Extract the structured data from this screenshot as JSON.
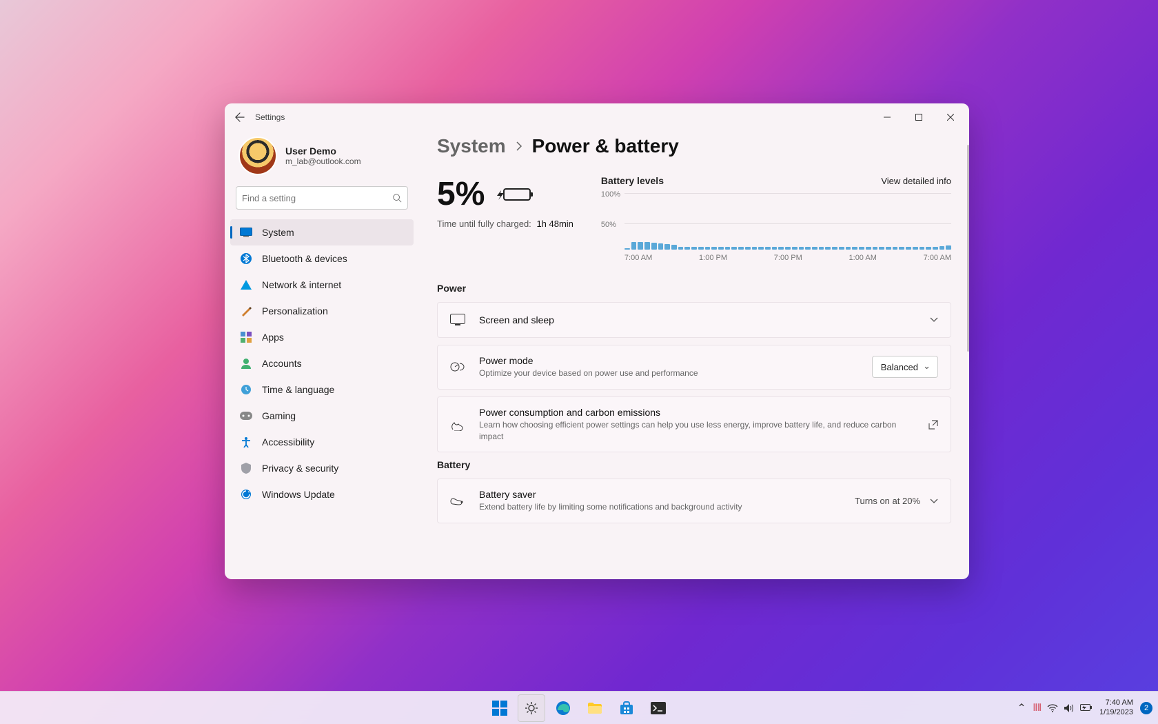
{
  "window": {
    "title": "Settings"
  },
  "user": {
    "name": "User Demo",
    "email": "m_lab@outlook.com"
  },
  "search": {
    "placeholder": "Find a setting"
  },
  "nav": [
    {
      "label": "System",
      "icon": "system",
      "active": true
    },
    {
      "label": "Bluetooth & devices",
      "icon": "bluetooth"
    },
    {
      "label": "Network & internet",
      "icon": "network"
    },
    {
      "label": "Personalization",
      "icon": "personalization"
    },
    {
      "label": "Apps",
      "icon": "apps"
    },
    {
      "label": "Accounts",
      "icon": "accounts"
    },
    {
      "label": "Time & language",
      "icon": "time"
    },
    {
      "label": "Gaming",
      "icon": "gaming"
    },
    {
      "label": "Accessibility",
      "icon": "accessibility"
    },
    {
      "label": "Privacy & security",
      "icon": "privacy"
    },
    {
      "label": "Windows Update",
      "icon": "update"
    }
  ],
  "breadcrumb": {
    "parent": "System",
    "current": "Power & battery"
  },
  "battery": {
    "percent": "5%",
    "time_label": "Time until fully charged:",
    "time_value": "1h 48min"
  },
  "chart_data": {
    "type": "bar",
    "title": "Battery levels",
    "link": "View detailed info",
    "ylabel": "",
    "ylim": [
      0,
      100
    ],
    "y_ticks": [
      "100%",
      "50%"
    ],
    "categories": [
      "7:00 AM",
      "1:00 PM",
      "7:00 PM",
      "1:00 AM",
      "7:00 AM"
    ],
    "values": [
      3,
      14,
      14,
      13,
      12,
      11,
      10,
      9,
      5,
      5,
      5,
      5,
      5,
      5,
      5,
      5,
      5,
      5,
      5,
      5,
      5,
      5,
      5,
      5,
      5,
      5,
      5,
      5,
      5,
      5,
      5,
      5,
      5,
      5,
      5,
      5,
      5,
      5,
      5,
      5,
      5,
      5,
      5,
      5,
      5,
      5,
      5,
      6,
      7
    ]
  },
  "sections": {
    "power": "Power",
    "battery": "Battery"
  },
  "cards": {
    "screen_sleep": {
      "title": "Screen and sleep"
    },
    "power_mode": {
      "title": "Power mode",
      "sub": "Optimize your device based on power use and performance",
      "value": "Balanced"
    },
    "carbon": {
      "title": "Power consumption and carbon emissions",
      "sub": "Learn how choosing efficient power settings can help you use less energy, improve battery life, and reduce carbon impact"
    },
    "saver": {
      "title": "Battery saver",
      "sub": "Extend battery life by limiting some notifications and background activity",
      "status": "Turns on at 20%"
    }
  },
  "taskbar": {
    "time": "7:40 AM",
    "date": "1/19/2023",
    "notification_count": "2"
  }
}
